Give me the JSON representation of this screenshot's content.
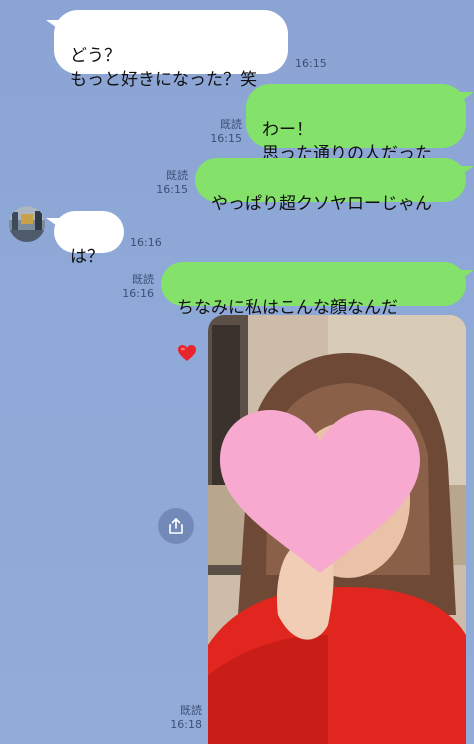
{
  "messages": [
    {
      "side": "in",
      "text": "どう？\nもっと好きになった？笑",
      "time": "16:15"
    },
    {
      "side": "out",
      "text": "わー！\n思った通りの人だった",
      "read": "既読",
      "time": "16:15"
    },
    {
      "side": "out",
      "text": "やっぱり超クソヤローじゃん",
      "read": "既読",
      "time": "16:15"
    },
    {
      "side": "in",
      "text": "は？",
      "time": "16:16"
    },
    {
      "side": "out",
      "text": "ちなみに私はこんな顔なんだ",
      "read": "既読",
      "time": "16:16"
    }
  ],
  "photo_message": {
    "read": "既読",
    "time": "16:18"
  },
  "icons": {
    "share": "share-icon",
    "heart": "heart-emoji-icon",
    "avatar": "avatar"
  },
  "colors": {
    "background": "#8ea6d6",
    "incoming_bubble": "#ffffff",
    "outgoing_bubble": "#84e26a",
    "emoji_heart": "#e8242c",
    "cover_heart": "#f8a9d0"
  }
}
